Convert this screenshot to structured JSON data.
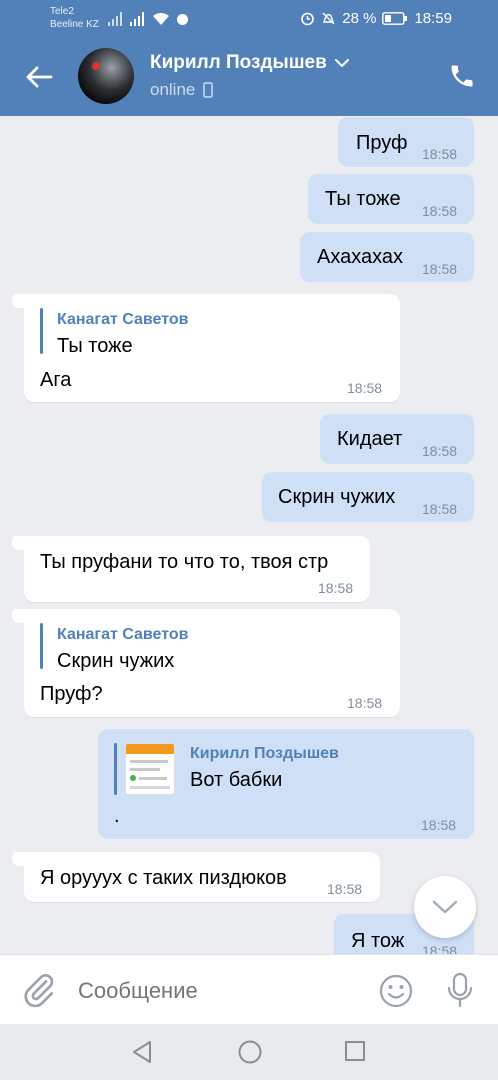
{
  "status_bar": {
    "carrier_1": "Tele2",
    "carrier_2": "Beeline KZ",
    "battery_percent": "28 %",
    "time": "18:59"
  },
  "header": {
    "contact_name": "Кирилл Поздышев",
    "status": "online"
  },
  "messages": [
    {
      "dir": "out",
      "text": "Пруф",
      "time": "18:58"
    },
    {
      "dir": "out",
      "text": "Ты тоже",
      "time": "18:58"
    },
    {
      "dir": "out",
      "text": "Ахахахах",
      "time": "18:58"
    },
    {
      "dir": "in",
      "quote_name": "Канагат Саветов",
      "quote_text": "Ты тоже",
      "text": "Ага",
      "time": "18:58"
    },
    {
      "dir": "out",
      "text": "Кидает",
      "time": "18:58"
    },
    {
      "dir": "out",
      "text": "Скрин чужих",
      "time": "18:58"
    },
    {
      "dir": "in",
      "text": "Ты пруфани то что то, твоя стр",
      "time": "18:58"
    },
    {
      "dir": "in",
      "quote_name": "Канагат Саветов",
      "quote_text": "Скрин чужих",
      "text": "Пруф?",
      "time": "18:58"
    },
    {
      "dir": "out",
      "quote_name": "Кирилл Поздышев",
      "quote_text": "Вот бабки",
      "text": ".",
      "time": "18:58"
    },
    {
      "dir": "in",
      "text": "Я орууух с таких пиздюков",
      "time": "18:58"
    },
    {
      "dir": "out",
      "text": "Я тож",
      "time": "18:58"
    }
  ],
  "composer": {
    "placeholder": "Сообщение"
  }
}
